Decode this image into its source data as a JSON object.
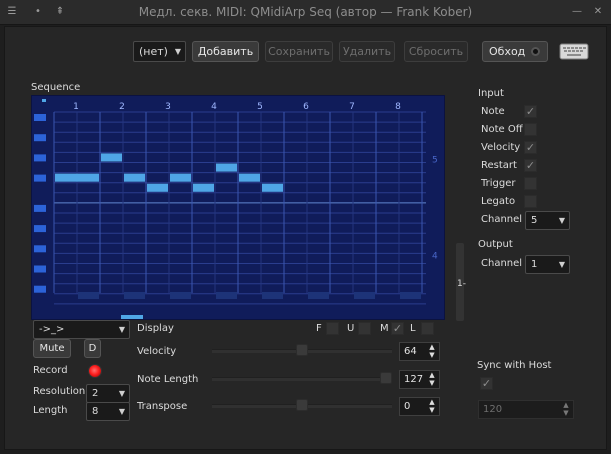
{
  "window": {
    "title": "Медл. секв. MIDI: QMidiArp Seq (автор — Frank Kober)",
    "menu_glyph": "☰",
    "pin_glyph": "•",
    "up_glyph": "⇞",
    "minimize_glyph": "—",
    "close_glyph": "✕"
  },
  "toolbar": {
    "preset": "(нет)",
    "add_label": "Добавить",
    "save_label": "Сохранить",
    "delete_label": "Удалить",
    "reset_label": "Сбросить",
    "bypass_label": "Обход"
  },
  "sequence": {
    "label": "Sequence",
    "beat_numbers": [
      "1",
      "2",
      "3",
      "4",
      "5",
      "6",
      "7",
      "8"
    ],
    "octave_labels": [
      "5",
      "4"
    ],
    "steps": [
      {
        "row": 6,
        "col": 0,
        "len": 2
      },
      {
        "row": 4,
        "col": 2,
        "len": 1
      },
      {
        "row": 6,
        "col": 3,
        "len": 1
      },
      {
        "row": 7,
        "col": 4,
        "len": 1
      },
      {
        "row": 6,
        "col": 5,
        "len": 1
      },
      {
        "row": 7,
        "col": 6,
        "len": 1
      },
      {
        "row": 5,
        "col": 7,
        "len": 1
      },
      {
        "row": 6,
        "col": 8,
        "len": 1
      },
      {
        "row": 7,
        "col": 9,
        "len": 1
      }
    ],
    "side_marker": "1-"
  },
  "controls": {
    "loop_mode": "->_>",
    "mute_label": "Mute",
    "d_label": "D",
    "record_label": "Record",
    "resolution_label": "Resolution",
    "resolution_value": "2",
    "length_label": "Length",
    "length_value": "8"
  },
  "display": {
    "label": "Display",
    "f_label": "F",
    "u_label": "U",
    "m_label": "M",
    "l_label": "L",
    "velocity_label": "Velocity",
    "velocity_value": "64",
    "velocity_fraction": 0.5,
    "note_length_label": "Note Length",
    "note_length_value": "127",
    "note_length_fraction": 1.0,
    "transpose_label": "Transpose",
    "transpose_value": "0",
    "transpose_fraction": 0.5
  },
  "input": {
    "heading": "Input",
    "note_label": "Note",
    "note_off_label": "Note Off",
    "velocity_label": "Velocity",
    "restart_label": "Restart",
    "trigger_label": "Trigger",
    "legato_label": "Legato",
    "channel_label": "Channel",
    "channel_value": "5"
  },
  "output": {
    "heading": "Output",
    "channel_label": "Channel",
    "channel_value": "1"
  },
  "sync": {
    "label": "Sync with Host",
    "tempo_value": "120"
  },
  "colors": {
    "grid_bg": "#101c5a",
    "note_fill": "#4fa6e6",
    "accent_red": "#ff2a2a"
  }
}
